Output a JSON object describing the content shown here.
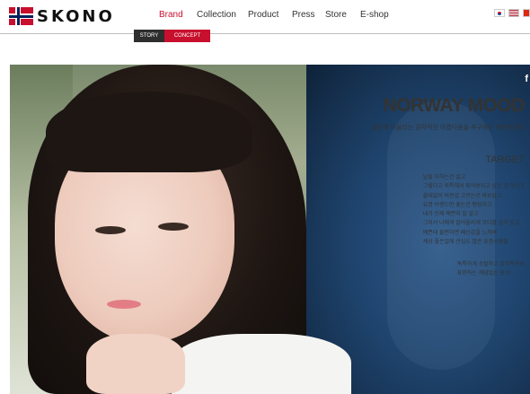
{
  "brand": {
    "logo_text": "SKONO"
  },
  "nav": {
    "items": [
      {
        "label": "Brand",
        "active": true
      },
      {
        "label": "Collection",
        "active": false
      },
      {
        "label": "Product",
        "active": false
      },
      {
        "label": "Press",
        "active": false
      },
      {
        "label": "Store",
        "active": false
      },
      {
        "label": "E-shop",
        "active": false
      }
    ]
  },
  "languages": [
    "korean-flag-icon",
    "us-flag-icon",
    "china-flag-icon"
  ],
  "subnav": {
    "story": "STORY",
    "concept": "CONCEPT"
  },
  "hero": {
    "title": "NORWAY MOOD",
    "subtitle": "일상에 어울리는 감각적인 아름다움을 추구하는 패션브랜드",
    "target_heading": "TARGET",
    "target_lines": [
      "남들 다하는건 싫고",
      "그렇다고 독특해서 튀어보이고 싶은 건 아니고",
      "쓸데없이 비싼걸 고르는건 바보같고",
      "유명 브랜드만 좇는건 평장이고",
      "내가 언제 예쁜지 잘 알고",
      "그러서 나에게 잘어울리게 코디할 감각 있고",
      "예쁜데 불편하면 배신감을 느끼며",
      "세상 좋은일에 관심도 많은 요즘사람들"
    ],
    "closing_lines": [
      "독특하게 소탈하고 감각적으로",
      "표현하는 개념있는 당신!"
    ],
    "social_label": "f"
  },
  "colors": {
    "accent": "#c8102e",
    "subnav_dark": "#2e2e2e"
  }
}
